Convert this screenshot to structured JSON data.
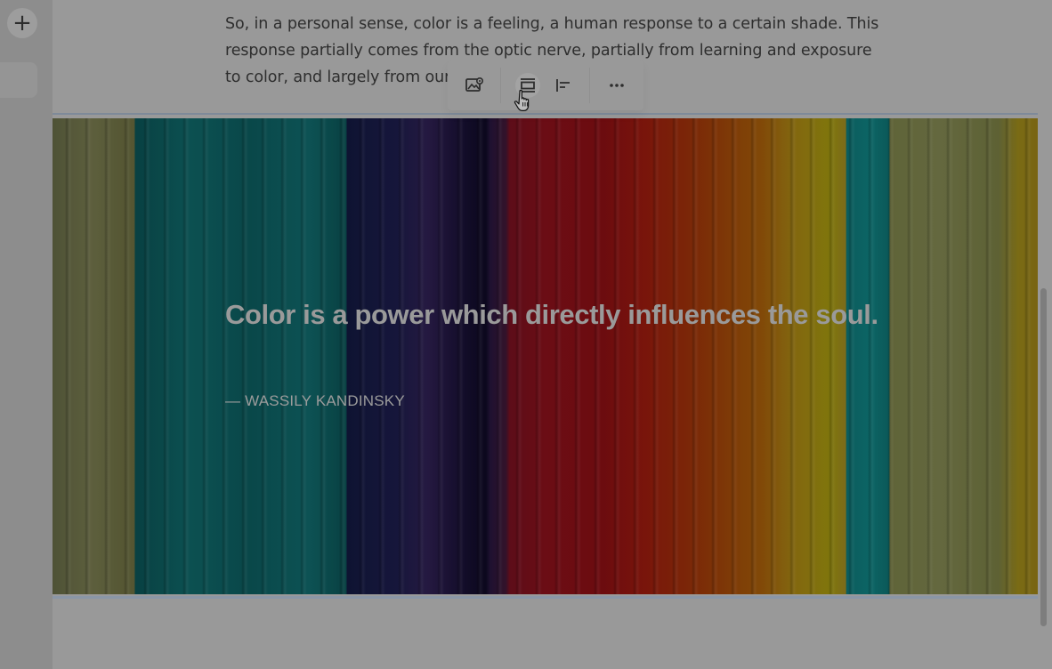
{
  "app": {
    "add_icon": "plus-icon",
    "background": "#999999"
  },
  "paragraph": {
    "lines": [
      "So, in a personal sense, color is a feeling, a human response to a certain shade. This",
      "response partially comes from the optic nerve, partially from learning and exposure",
      "to color, and largely from our"
    ]
  },
  "toolbar": {
    "buttons": [
      {
        "name": "change-image-button",
        "icon": "image-settings-icon",
        "active": false
      },
      {
        "name": "full-width-button",
        "icon": "layout-full-width-icon",
        "active": true
      },
      {
        "name": "align-left-button",
        "icon": "align-left-icon",
        "active": false
      },
      {
        "name": "more-options-button",
        "icon": "more-horizontal-icon",
        "active": false
      }
    ]
  },
  "image_block": {
    "quote": "Color is a power which directly influences the soul.",
    "citation": "— WASSILY KANDINSKY",
    "accent_colors": [
      "#0e5c5d",
      "#1a1a44",
      "#7c0e12",
      "#957412",
      "#727748"
    ]
  }
}
